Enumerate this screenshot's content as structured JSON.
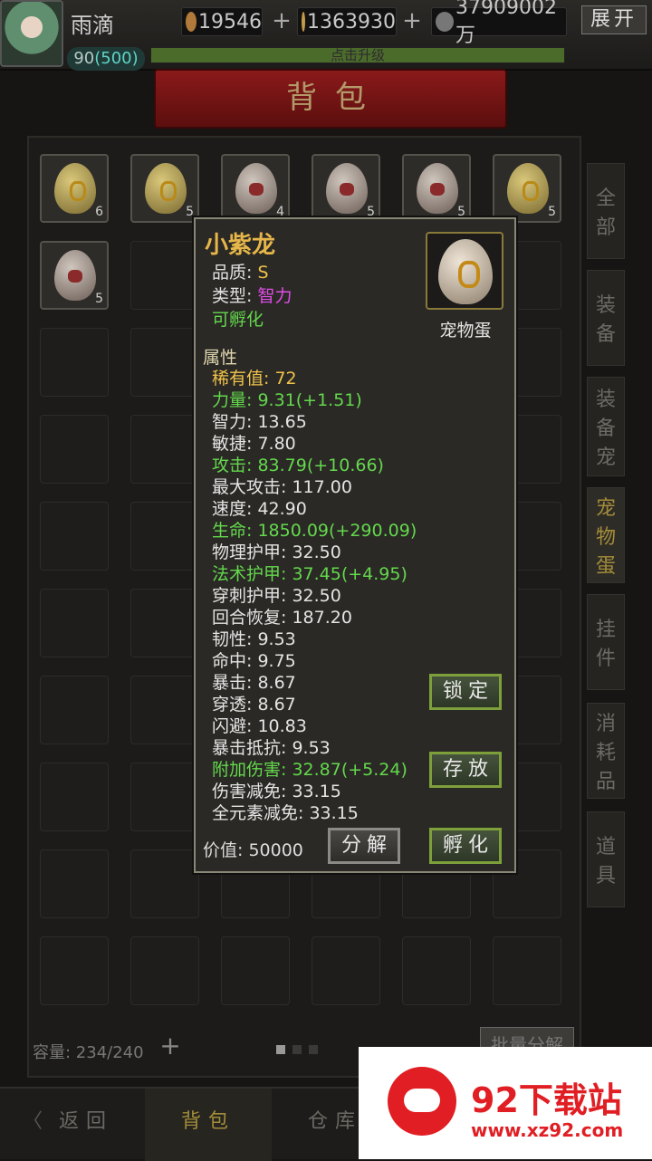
{
  "header": {
    "player_name": "雨滴",
    "level": "90",
    "level_max": "(500)",
    "expbar_text": "点击升级",
    "res1": "19546",
    "res2": "1363930",
    "res3": "37909002万",
    "expand_label": "展开"
  },
  "title": "背包",
  "side_tabs": [
    {
      "label": "全部"
    },
    {
      "label": "装备"
    },
    {
      "label": "装备宠"
    },
    {
      "label": "宠物蛋"
    },
    {
      "label": "挂件"
    },
    {
      "label": "消耗品"
    },
    {
      "label": "道具"
    }
  ],
  "items": [
    {
      "count": "6"
    },
    {
      "count": "5"
    },
    {
      "count": "4"
    },
    {
      "count": "5"
    },
    {
      "count": "5"
    },
    {
      "count": "5"
    },
    {
      "count": "5"
    }
  ],
  "bottom": {
    "capacity": "容量: 234/240",
    "plus": "+",
    "batch_label": "批量分解"
  },
  "nav": {
    "back": "返回",
    "bag": "背包",
    "warehouse": "仓库"
  },
  "popup": {
    "name": "小紫龙",
    "quality_label": "品质:",
    "quality_value": "S",
    "type_label": "类型:",
    "type_value": "智力",
    "hatchable": "可孵化",
    "item_type": "宠物蛋",
    "attr_heading": "属性",
    "stats": [
      {
        "text": "稀有值: 72",
        "color": "yellow"
      },
      {
        "text": "力量: 9.31(+1.51)",
        "color": "green"
      },
      {
        "text": "智力: 13.65",
        "color": "white"
      },
      {
        "text": "敏捷: 7.80",
        "color": "white"
      },
      {
        "text": "攻击: 83.79(+10.66)",
        "color": "green"
      },
      {
        "text": "最大攻击: 117.00",
        "color": "white"
      },
      {
        "text": "速度: 42.90",
        "color": "white"
      },
      {
        "text": "生命: 1850.09(+290.09)",
        "color": "green"
      },
      {
        "text": "物理护甲: 32.50",
        "color": "white"
      },
      {
        "text": "法术护甲: 37.45(+4.95)",
        "color": "green"
      },
      {
        "text": "穿刺护甲: 32.50",
        "color": "white"
      },
      {
        "text": "回合恢复: 187.20",
        "color": "white"
      },
      {
        "text": "韧性: 9.53",
        "color": "white"
      },
      {
        "text": "命中: 9.75",
        "color": "white"
      },
      {
        "text": "暴击: 8.67",
        "color": "white"
      },
      {
        "text": "穿透: 8.67",
        "color": "white"
      },
      {
        "text": "闪避: 10.83",
        "color": "white"
      },
      {
        "text": "暴击抵抗: 9.53",
        "color": "white"
      },
      {
        "text": "附加伤害: 32.87(+5.24)",
        "color": "green"
      },
      {
        "text": "伤害减免: 33.15",
        "color": "white"
      },
      {
        "text": "全元素减免: 33.15",
        "color": "white"
      }
    ],
    "value_label": "价值: 50000",
    "btn_lock": "锁定",
    "btn_store": "存放",
    "btn_decompose": "分解",
    "btn_hatch": "孵化"
  },
  "watermark": {
    "title": "92下载站",
    "url": "www.xz92.com"
  },
  "colors": {
    "green": "#64d84d",
    "yellow": "#f0c24a",
    "purple": "#e04de8",
    "gold": "#e6b64a"
  }
}
